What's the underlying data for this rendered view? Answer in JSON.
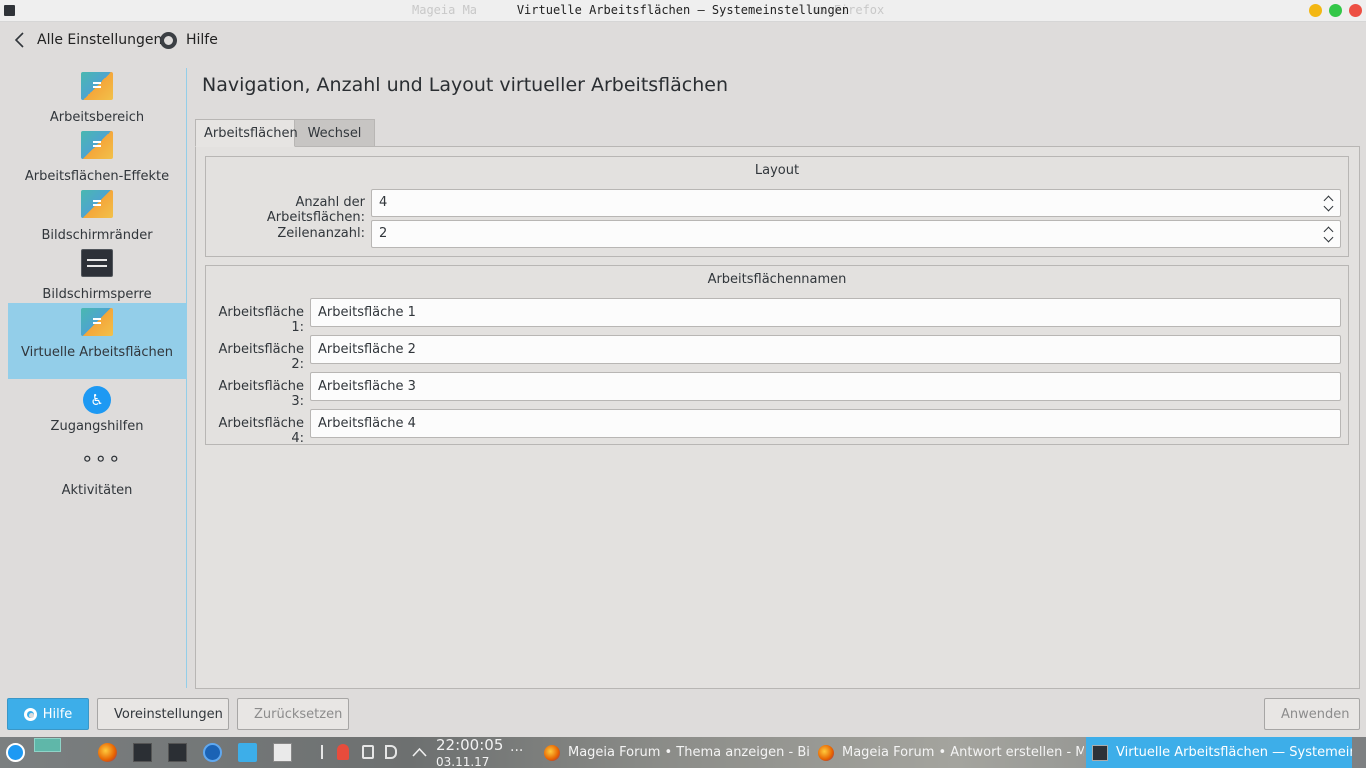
{
  "window": {
    "title": "Virtuelle Arbeitsflächen — Systemeinstellungen",
    "ghost_title_left": "Mageia Ma",
    "ghost_title_right": "ox Firefox"
  },
  "toolbar": {
    "back_label": "Alle Einstellungen",
    "help_label": "Hilfe"
  },
  "sidebar": {
    "items": [
      {
        "label": "Arbeitsbereich",
        "icon": "workspace-icon"
      },
      {
        "label": "Arbeitsflächen-Effekte",
        "icon": "desktop-effects-icon"
      },
      {
        "label": "Bildschirmränder",
        "icon": "screen-edges-icon"
      },
      {
        "label": "Bildschirmsperre",
        "icon": "screen-lock-icon"
      },
      {
        "label": "Virtuelle Arbeitsflächen",
        "icon": "virtual-desktops-icon",
        "active": true
      },
      {
        "label": "Zugangshilfen",
        "icon": "accessibility-icon"
      },
      {
        "label": "Aktivitäten",
        "icon": "activities-icon"
      }
    ]
  },
  "main": {
    "title": "Navigation, Anzahl und Layout virtueller Arbeitsflächen",
    "tabs": [
      {
        "label": "Arbeitsflächen",
        "selected": true
      },
      {
        "label": "Wechsel",
        "selected": false
      }
    ],
    "layout_group": {
      "title": "Layout",
      "desktop_count_label": "Anzahl der Arbeitsflächen:",
      "desktop_count_value": "4",
      "rows_label": "Zeilenanzahl:",
      "rows_value": "2"
    },
    "names_group": {
      "title": "Arbeitsflächennamen",
      "entries": [
        {
          "label": "Arbeitsfläche 1:",
          "value": "Arbeitsfläche 1"
        },
        {
          "label": "Arbeitsfläche 2:",
          "value": "Arbeitsfläche 2"
        },
        {
          "label": "Arbeitsfläche 3:",
          "value": "Arbeitsfläche 3"
        },
        {
          "label": "Arbeitsfläche 4:",
          "value": "Arbeitsfläche 4"
        }
      ]
    }
  },
  "buttons": {
    "help": "Hilfe",
    "defaults": "Voreinstellungen",
    "reset": "Zurücksetzen",
    "apply": "Anwenden"
  },
  "taskbar": {
    "clock": "22:00:05",
    "date": "03.11.17",
    "tasks": [
      {
        "label": "Mageia Forum • Thema anzeigen - Bilds..."
      },
      {
        "label": "Mageia Forum • Antwort erstellen - Mo..."
      },
      {
        "label": "Virtuelle Arbeitsflächen — Systemeins..."
      }
    ]
  },
  "colors": {
    "accent": "#3daee9",
    "selection": "#93cee9",
    "window_bg": "#dedcdb"
  }
}
